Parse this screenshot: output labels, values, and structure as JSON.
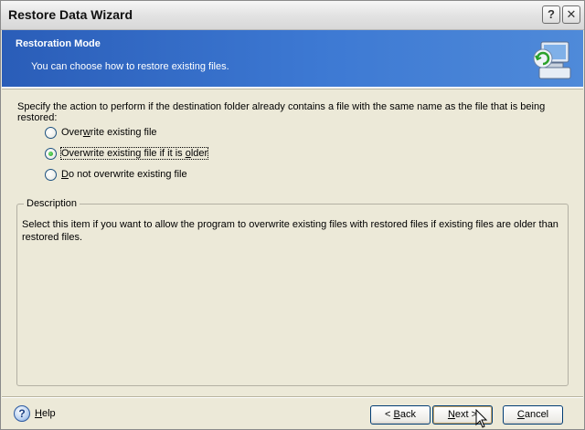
{
  "window": {
    "title": "Restore Data Wizard",
    "help_glyph": "?",
    "close_glyph": "✕"
  },
  "banner": {
    "heading": "Restoration Mode",
    "subtitle": "You can choose how to restore existing files.",
    "icon": "restore-computer-icon",
    "gradient_start": "#2a5db8",
    "gradient_end": "#4f8ad9"
  },
  "instruction": "Specify the action to perform if the destination folder already contains a file with the same name as the file that is being restored:",
  "options": [
    {
      "label_pre": "Over",
      "mnemonic": "w",
      "label_post": "rite existing file",
      "checked": false
    },
    {
      "label_pre": "Overwrite existing file if it is ",
      "mnemonic": "o",
      "label_post": "lder",
      "checked": true
    },
    {
      "label_pre": "",
      "mnemonic": "D",
      "label_post": "o not overwrite existing file",
      "checked": false
    }
  ],
  "description": {
    "legend": "Description",
    "text": "Select this item if you want to allow the program to overwrite existing files with restored files if existing files are older than restored files."
  },
  "footer": {
    "help_label": "Help",
    "help_mnemonic": "H",
    "help_rest": "elp",
    "back": {
      "pre": "< ",
      "mnemonic": "B",
      "post": "ack"
    },
    "next": {
      "pre": "",
      "mnemonic": "N",
      "post": "ext >"
    },
    "cancel": {
      "pre": "",
      "mnemonic": "C",
      "post": "ancel"
    }
  }
}
